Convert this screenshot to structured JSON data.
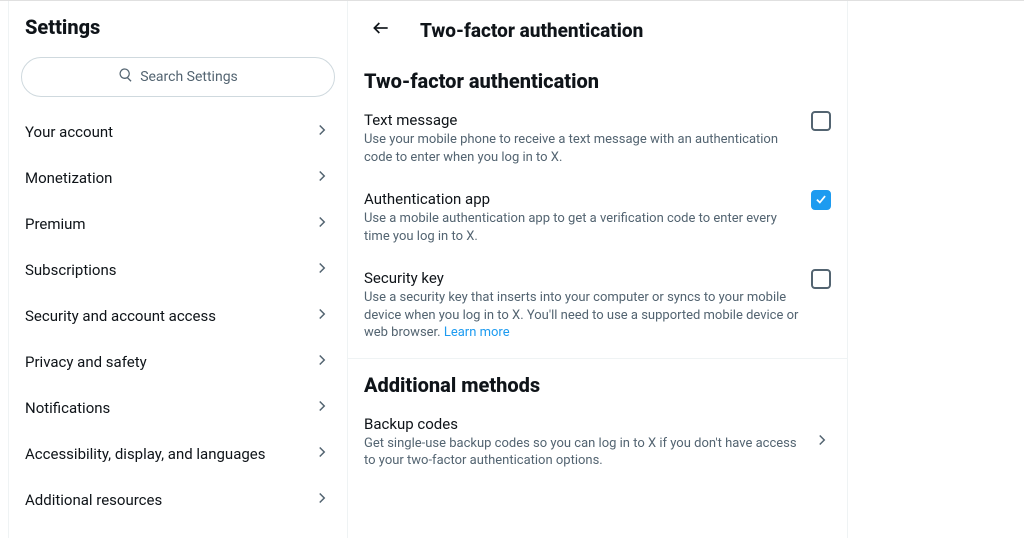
{
  "sidebar": {
    "title": "Settings",
    "search_placeholder": "Search Settings",
    "items": [
      {
        "label": "Your account"
      },
      {
        "label": "Monetization"
      },
      {
        "label": "Premium"
      },
      {
        "label": "Subscriptions"
      },
      {
        "label": "Security and account access"
      },
      {
        "label": "Privacy and safety"
      },
      {
        "label": "Notifications"
      },
      {
        "label": "Accessibility, display, and languages"
      },
      {
        "label": "Additional resources"
      }
    ]
  },
  "main": {
    "header_title": "Two-factor authentication",
    "section1_heading": "Two-factor authentication",
    "options": [
      {
        "title": "Text message",
        "desc": "Use your mobile phone to receive a text message with an authentication code to enter when you log in to X.",
        "checked": false
      },
      {
        "title": "Authentication app",
        "desc": "Use a mobile authentication app to get a verification code to enter every time you log in to X.",
        "checked": true
      },
      {
        "title": "Security key",
        "desc": "Use a security key that inserts into your computer or syncs to your mobile device when you log in to X. You'll need to use a supported mobile device or web browser. ",
        "learn_more": "Learn more",
        "checked": false
      }
    ],
    "section2_heading": "Additional methods",
    "backup": {
      "title": "Backup codes",
      "desc": "Get single-use backup codes so you can log in to X if you don't have access to your two-factor authentication options."
    }
  }
}
